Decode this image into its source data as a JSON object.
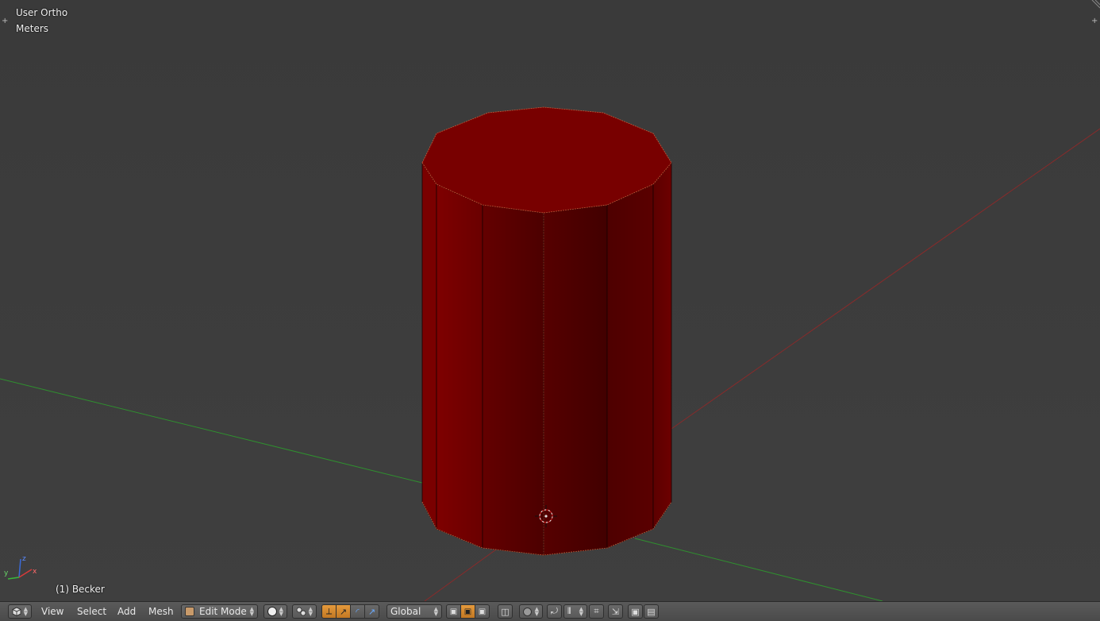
{
  "viewport": {
    "view_name": "User Ortho",
    "units": "Meters",
    "object_info": "(1) Becker",
    "axis_labels": {
      "x": "x",
      "y": "y",
      "z": "z"
    },
    "colors": {
      "x_axis": "#8a2a2a",
      "y_axis": "#2f8f2f",
      "mesh": "#7a0000",
      "mesh_dark": "#4a0000"
    }
  },
  "header": {
    "editor_type_icon": "3d-view-cube-icon",
    "menus": [
      "View",
      "Select",
      "Add",
      "Mesh"
    ],
    "mode": "Edit Mode",
    "mode_icon": "edit-mode-icon",
    "orientation": "Global",
    "accent_color": "#e08a2c"
  }
}
